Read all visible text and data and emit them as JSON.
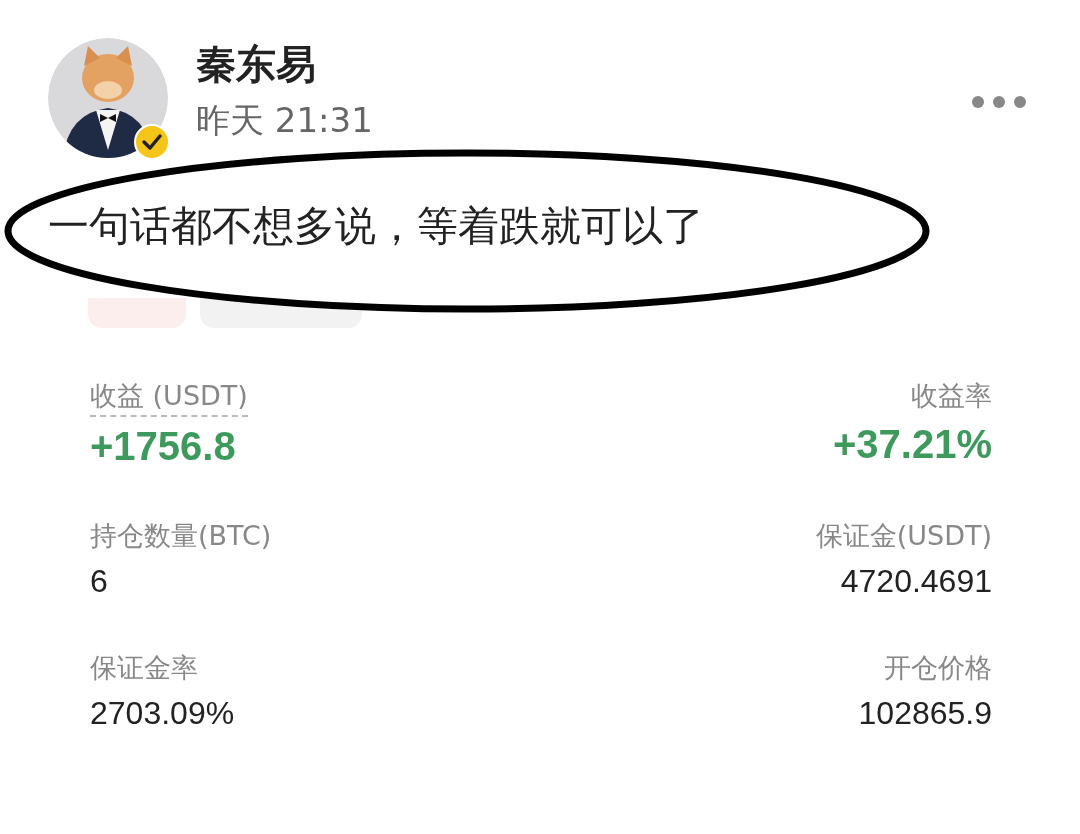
{
  "post": {
    "author": {
      "name": "秦东易",
      "verified": true
    },
    "time": "昨天 21:31",
    "text": "一句话都不想多说，等着跌就可以了"
  },
  "stats": [
    {
      "label": "收益 (USDT)",
      "value": "+1756.8",
      "kind": "profit",
      "underlined": true
    },
    {
      "label": "收益率",
      "value": "+37.21%",
      "kind": "profit",
      "underlined": false
    },
    {
      "label": "持仓数量(BTC)",
      "value": "6",
      "kind": "plain",
      "underlined": false
    },
    {
      "label": "保证金(USDT)",
      "value": "4720.4691",
      "kind": "plain",
      "underlined": false
    },
    {
      "label": "保证金率",
      "value": "2703.09%",
      "kind": "plain",
      "underlined": false
    },
    {
      "label": "开仓价格",
      "value": "102865.9",
      "kind": "plain",
      "underlined": false
    }
  ]
}
